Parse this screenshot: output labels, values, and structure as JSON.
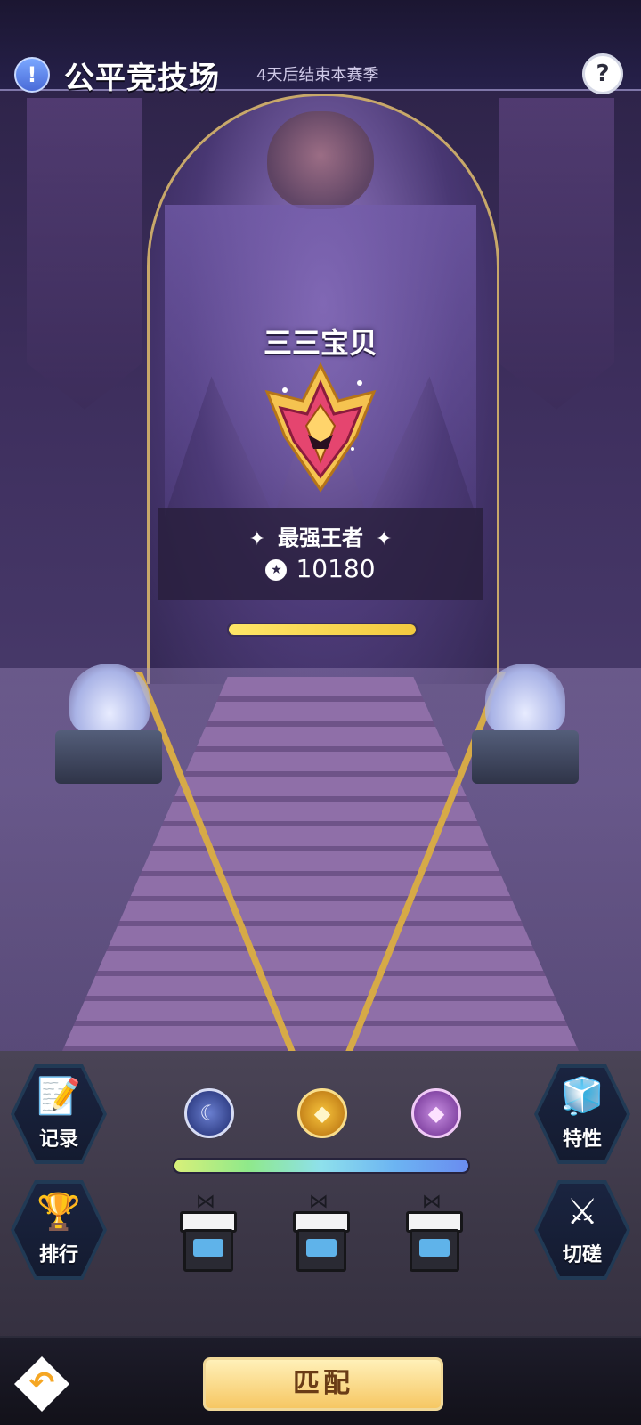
{
  "header": {
    "title": "公平竞技场",
    "subtitle": "4天后结束本赛季",
    "info_icon": "exclamation-icon",
    "help_icon": "question-icon"
  },
  "player": {
    "name": "三三宝贝",
    "rank_title": "最强王者",
    "points": "10180",
    "rank_progress": 1.0
  },
  "menu": {
    "records": {
      "label": "记录",
      "icon": "notebook-pen-icon"
    },
    "traits": {
      "label": "特性",
      "icon": "cubes-icon"
    },
    "ranking": {
      "label": "排行",
      "icon": "trophy-icon"
    },
    "spar": {
      "label": "切磋",
      "icon": "crossed-swords-icon"
    }
  },
  "rewards": {
    "gems": [
      "moon-gem-icon",
      "sun-gem-icon",
      "crystal-gem-icon"
    ],
    "season_progress": 1.0,
    "gift_count": 3
  },
  "footer": {
    "back_icon": "return-arrow-icon",
    "match_label": "匹配"
  },
  "colors": {
    "gold": "#d6aa47",
    "match_button": "#f6c763",
    "rank_bar": "#ffe667"
  }
}
